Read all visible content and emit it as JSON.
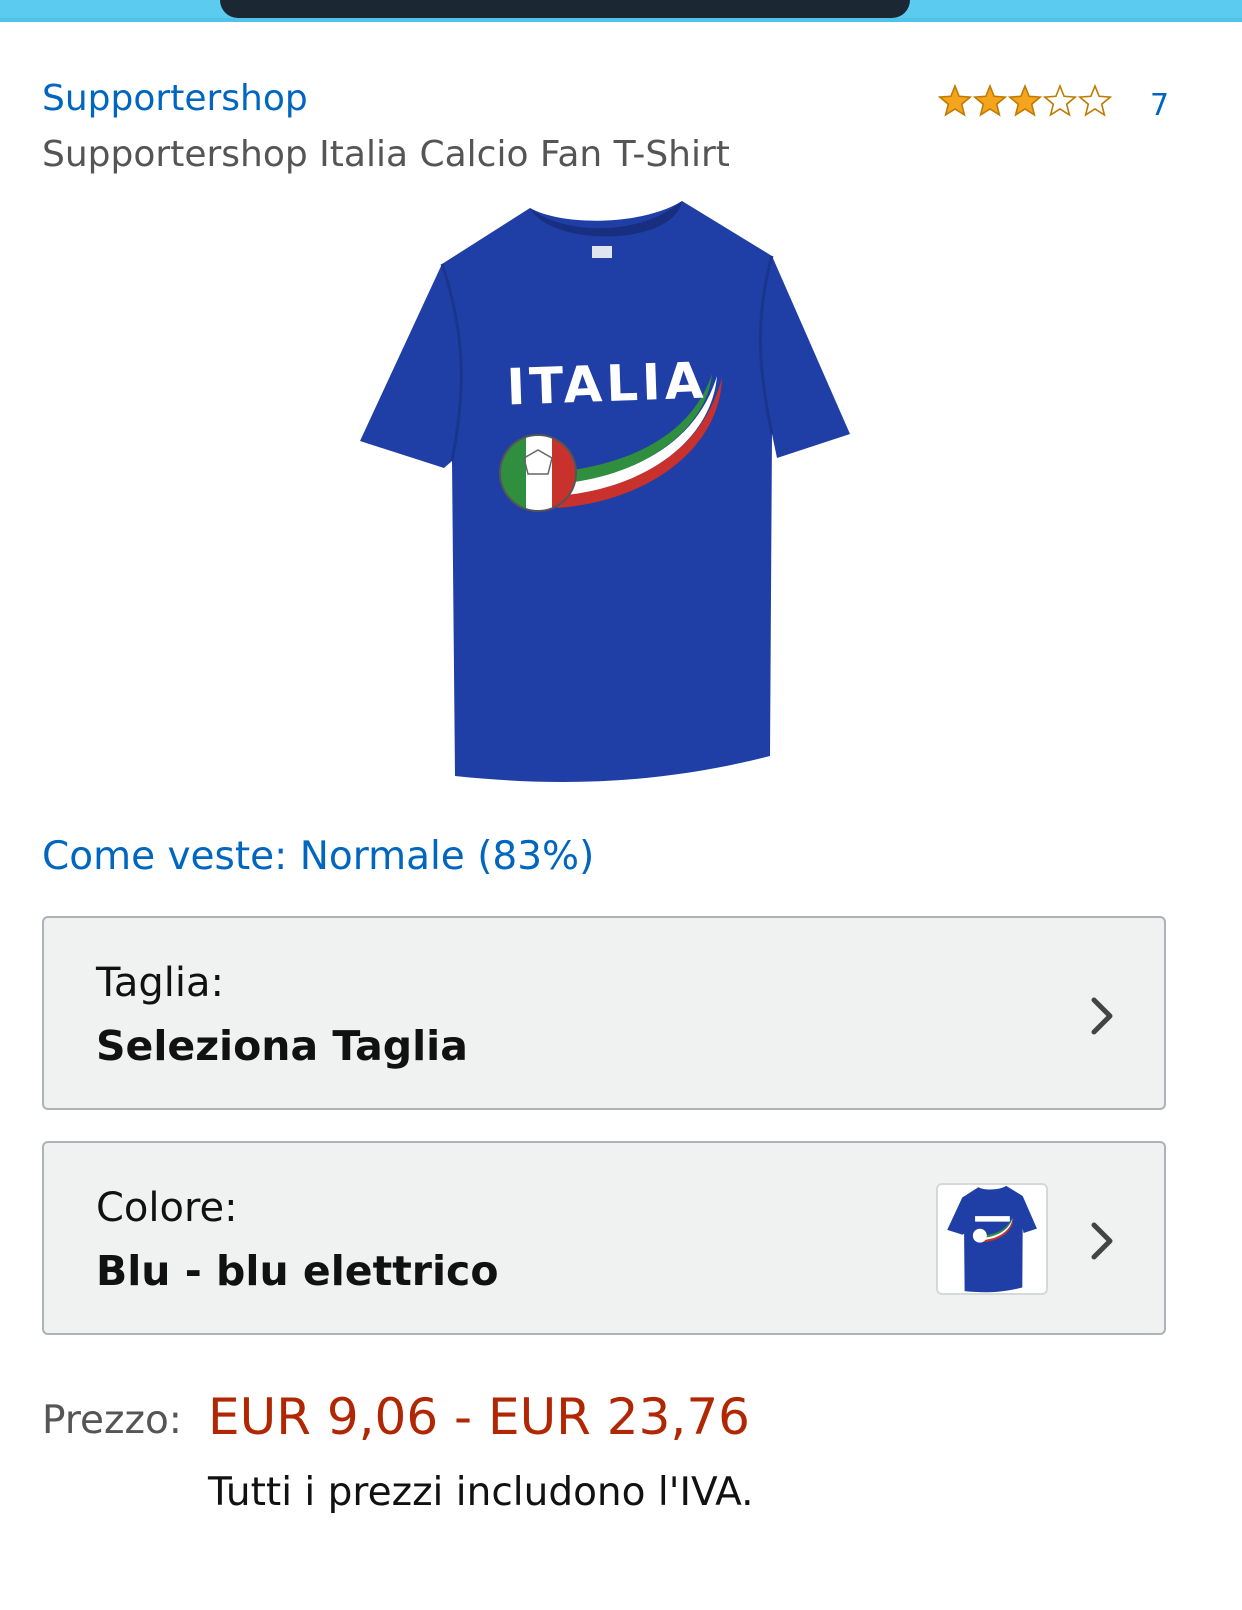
{
  "product": {
    "brand": "Supportershop",
    "title": "Supportershop Italia Calcio Fan T-Shirt",
    "rating_stars": 3,
    "rating_max": 5,
    "rating_count": "7",
    "image_print_text": "ITALIA"
  },
  "fit": {
    "text": "Come veste: Normale (83%)"
  },
  "size_selector": {
    "label": "Taglia:",
    "value": "Seleziona Taglia"
  },
  "color_selector": {
    "label": "Colore:",
    "value": "Blu - blu elettrico"
  },
  "price": {
    "label": "Prezzo:",
    "range": "EUR 9,06 - EUR 23,76",
    "vat_note": "Tutti i prezzi includono l'IVA."
  },
  "colors": {
    "link": "#0066c0",
    "price": "#b12704",
    "star_fill": "#f4a41d",
    "shirt_blue": "#1f3fa6",
    "selector_bg": "#f0f2f2"
  },
  "icons": [
    "star-icon",
    "chevron-right-icon"
  ]
}
